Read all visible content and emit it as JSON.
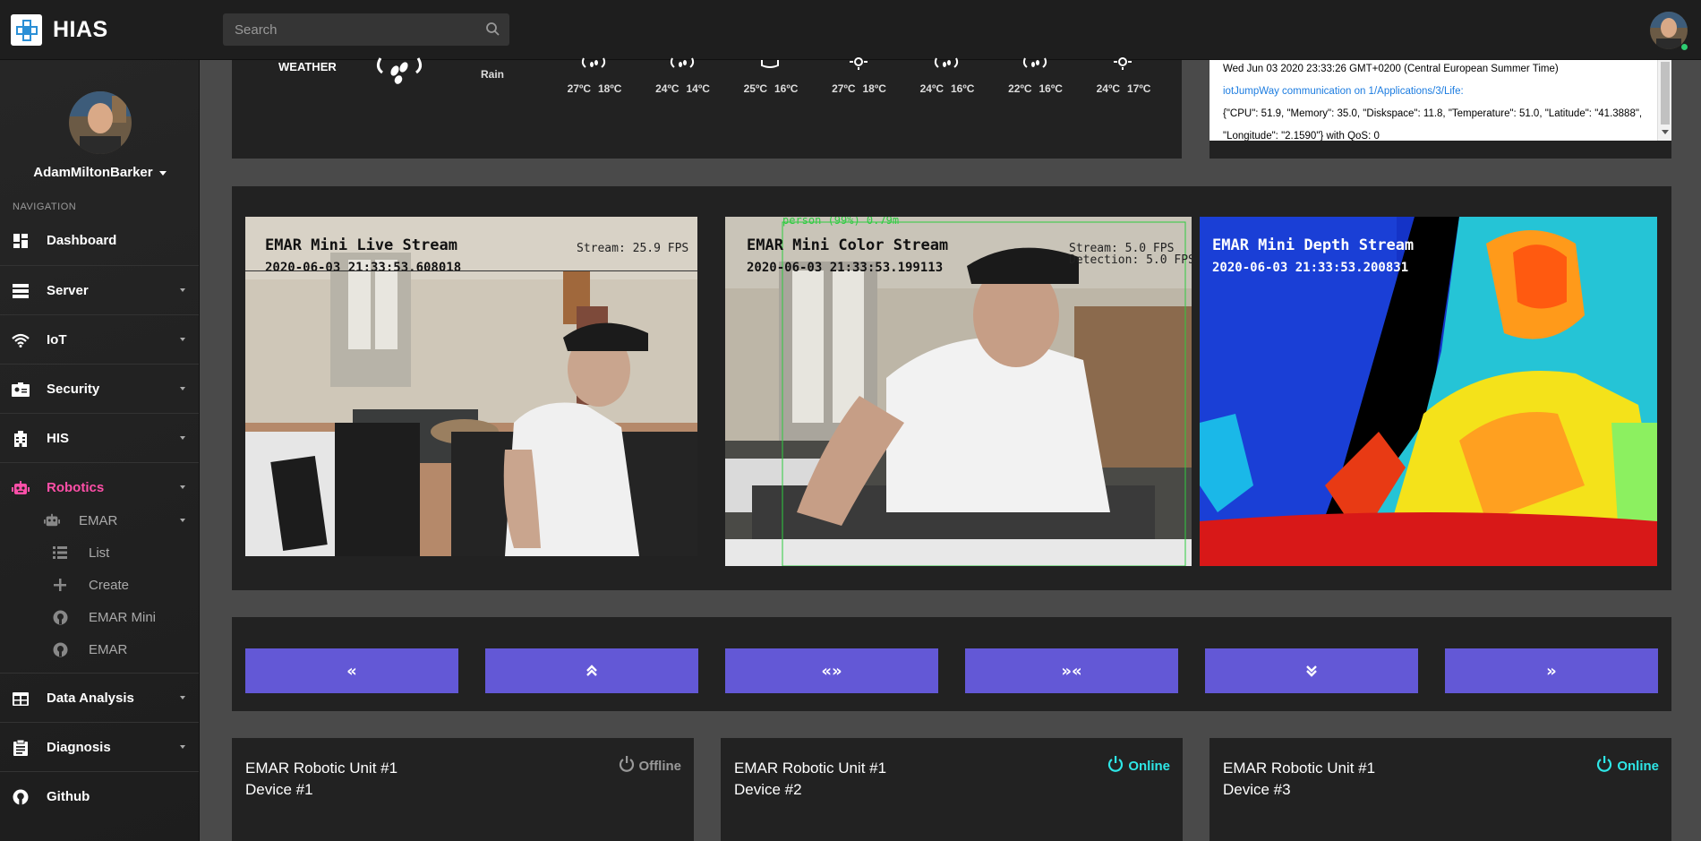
{
  "brand": {
    "name": "HIAS"
  },
  "search": {
    "placeholder": "Search"
  },
  "user": {
    "name": "AdamMiltonBarker"
  },
  "nav": {
    "heading": "NAVIGATION",
    "items": [
      {
        "label": "Dashboard",
        "icon": "dashboard-icon"
      },
      {
        "label": "Server",
        "icon": "server-icon"
      },
      {
        "label": "IoT",
        "icon": "wifi-icon"
      },
      {
        "label": "Security",
        "icon": "id-card-icon"
      },
      {
        "label": "HIS",
        "icon": "hospital-icon"
      },
      {
        "label": "Robotics",
        "icon": "robot-icon"
      },
      {
        "label": "Data Analysis",
        "icon": "table-icon"
      },
      {
        "label": "Diagnosis",
        "icon": "clipboard-icon"
      },
      {
        "label": "Github",
        "icon": "github-icon"
      }
    ],
    "robotics_sub": {
      "group": "EMAR",
      "items": [
        {
          "label": "List",
          "icon": "list-icon"
        },
        {
          "label": "Create",
          "icon": "plus-icon"
        },
        {
          "label": "EMAR Mini",
          "icon": "github-icon"
        },
        {
          "label": "EMAR",
          "icon": "github-icon"
        }
      ]
    }
  },
  "weather": {
    "label": "WEATHER",
    "condition": "Rain",
    "forecast": [
      {
        "high": "27ºC",
        "low": "18ºC",
        "icon": "rain-icon"
      },
      {
        "high": "24ºC",
        "low": "14ºC",
        "icon": "rain-icon"
      },
      {
        "high": "25ºC",
        "low": "16ºC",
        "icon": "cloud-icon"
      },
      {
        "high": "27ºC",
        "low": "18ºC",
        "icon": "sun-icon"
      },
      {
        "high": "24ºC",
        "low": "16ºC",
        "icon": "rain-icon"
      },
      {
        "high": "22ºC",
        "low": "16ºC",
        "icon": "rain-icon"
      },
      {
        "high": "24ºC",
        "low": "17ºC",
        "icon": "sun-icon"
      }
    ]
  },
  "log": {
    "timestamp": "Wed Jun 03 2020 23:33:26 GMT+0200 (Central European Summer Time)",
    "channel": "iotJumpWay communication on 1/Applications/3/Life:",
    "payload": "{\"CPU\": 51.9, \"Memory\": 35.0, \"Diskspace\": 11.8, \"Temperature\": 51.0, \"Latitude\": \"41.3888\",",
    "payload2": "\"Longitude\": \"2.1590\"} with QoS: 0"
  },
  "streams": [
    {
      "title": "EMAR Mini Live Stream",
      "date": "2020-06-03 21:33:53.608018",
      "fps": "Stream: 25.9 FPS"
    },
    {
      "title": "EMAR Mini Color Stream",
      "date": "2020-06-03 21:33:53.199113",
      "fps": "Stream: 5.0 FPS",
      "fps2": "Detection: 5.0 FPS",
      "detection": "person (99%) 0.79m"
    },
    {
      "title": "EMAR Mini Depth Stream",
      "date": "2020-06-03 21:33:53.200831"
    }
  ],
  "controls": [
    {
      "label": "«",
      "icon": "angle-double-left-icon"
    },
    {
      "label": "⌃",
      "icon": "angle-double-up-icon"
    },
    {
      "label": "«»",
      "icon": "arrows-out-icon"
    },
    {
      "label": "»«",
      "icon": "arrows-in-icon"
    },
    {
      "label": "⌄",
      "icon": "angle-double-down-icon"
    },
    {
      "label": "»",
      "icon": "angle-double-right-icon"
    }
  ],
  "devices": [
    {
      "title": "EMAR Robotic Unit #1",
      "subtitle": "Device #1",
      "status": "Offline",
      "status_color": "#999999"
    },
    {
      "title": "EMAR Robotic Unit #1",
      "subtitle": "Device #2",
      "status": "Online",
      "status_color": "#2ee6e6"
    },
    {
      "title": "EMAR Robotic Unit #1",
      "subtitle": "Device #3",
      "status": "Online",
      "status_color": "#2ee6e6"
    }
  ],
  "colors": {
    "accent": "#6358d6",
    "active_nav": "#ff4fa8",
    "online": "#2ee6e6"
  }
}
